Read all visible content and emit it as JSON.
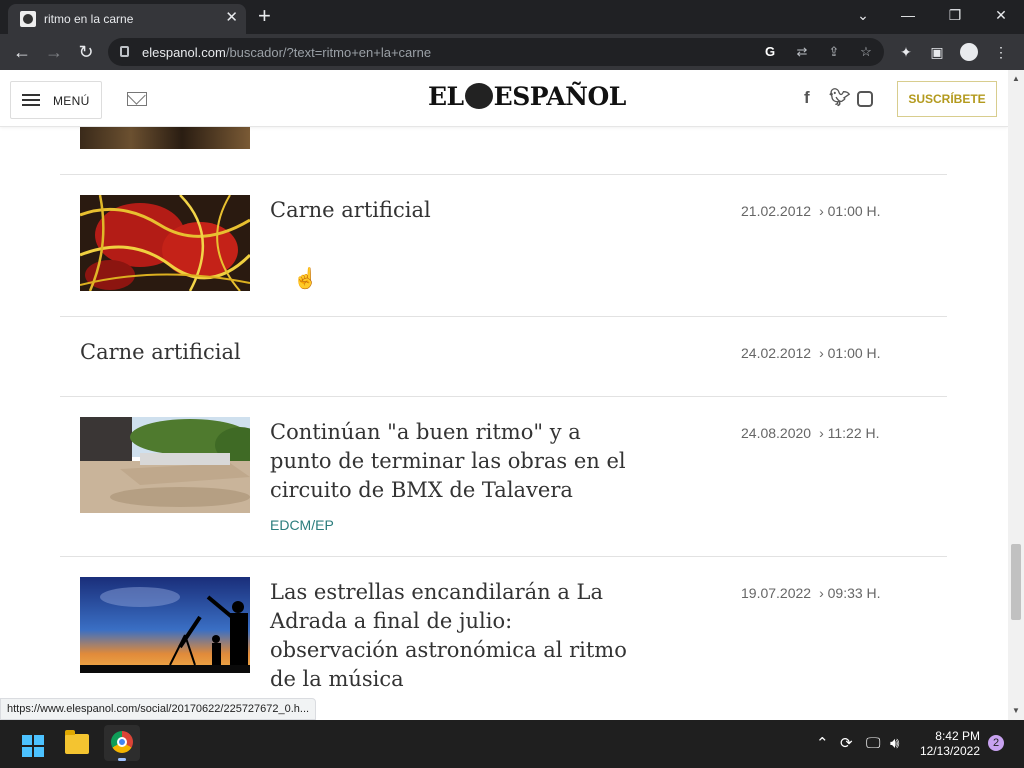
{
  "browser": {
    "tab_title": "ritmo en la carne",
    "tab_close": "✕",
    "new_tab": "+",
    "url_host": "elespanol.com",
    "url_path": "/buscador/?text=ritmo+en+la+carne"
  },
  "header": {
    "menu_label": "MENÚ",
    "logo_left": "EL",
    "logo_right": "ESPAÑOL",
    "subscribe_label": "SUSCRÍBETE"
  },
  "results": [
    {
      "title": "Carne artificial",
      "date": "21.02.2012",
      "time": "› 01:00 H.",
      "has_image": true
    },
    {
      "title": "Carne artificial",
      "date": "24.02.2012",
      "time": "› 01:00 H.",
      "has_image": false
    },
    {
      "title": "Continúan \"a buen ritmo\" y a punto de terminar las obras en el circuito de BMX de Talavera",
      "date": "24.08.2020",
      "time": "› 11:22 H.",
      "credit": "EDCM/EP",
      "has_image": true
    },
    {
      "title": "Las estrellas encandilarán a La Adrada a final de julio: observación astronómica al ritmo de la música",
      "date": "19.07.2022",
      "time": "› 09:33 H.",
      "has_image": true
    }
  ],
  "status_url": "https://www.elespanol.com/social/20170622/225727672_0.h...",
  "taskbar": {
    "time": "8:42 PM",
    "date": "12/13/2022",
    "notifications": "2"
  },
  "colors": {
    "chrome_dark": "#202124",
    "toolbar": "#35363a",
    "subscribe_accent": "#b39a1e",
    "credit_teal": "#2b7d7d"
  }
}
